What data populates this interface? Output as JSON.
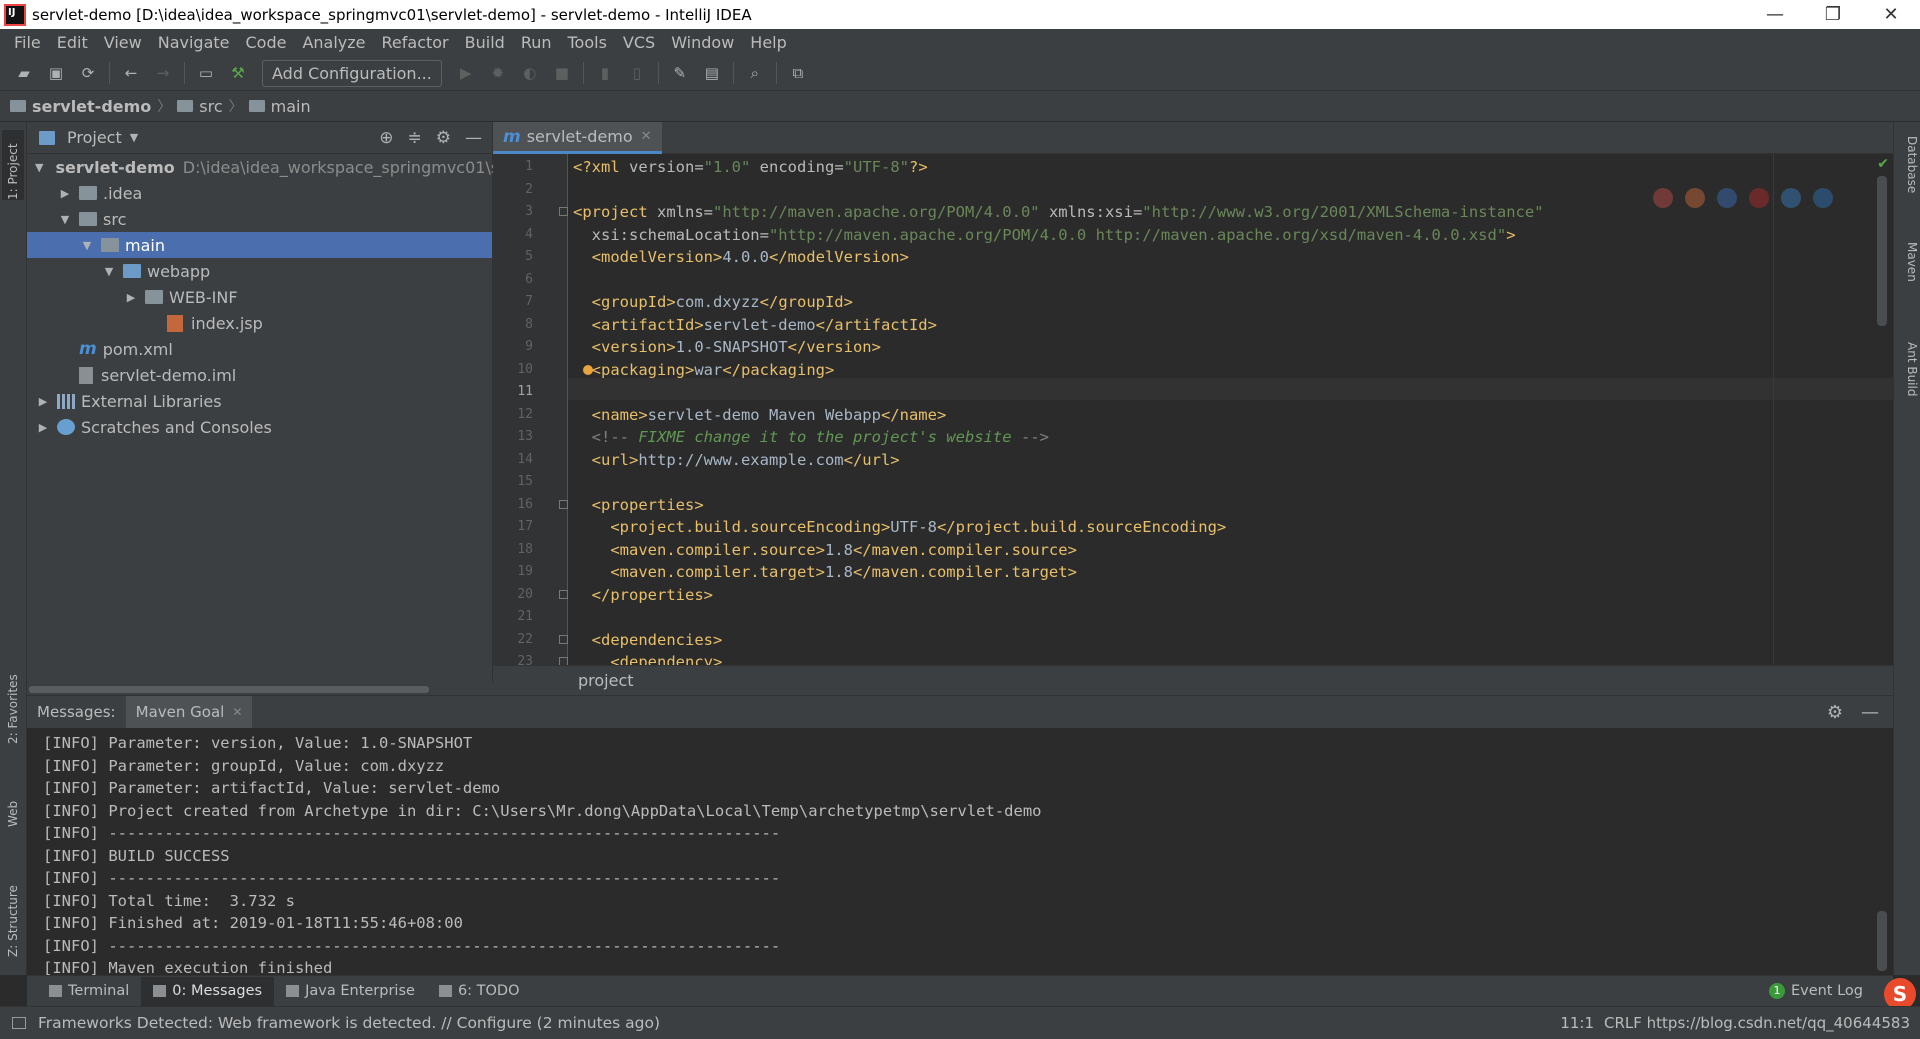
{
  "window": {
    "title": "servlet-demo [D:\\idea\\idea_workspace_springmvc01\\servlet-demo] - servlet-demo - IntelliJ IDEA",
    "controls": [
      "—",
      "❐",
      "✕"
    ]
  },
  "menu": [
    "File",
    "Edit",
    "View",
    "Navigate",
    "Code",
    "Analyze",
    "Refactor",
    "Build",
    "Run",
    "Tools",
    "VCS",
    "Window",
    "Help"
  ],
  "toolbar": {
    "add_configuration": "Add Configuration..."
  },
  "navbar": {
    "crumbs": [
      "servlet-demo",
      "src",
      "main"
    ]
  },
  "left_stripe": {
    "project": "1: Project",
    "favorites": "2: Favorites",
    "web": "Web",
    "structure": "Z: Structure"
  },
  "right_stripe": {
    "database": "Database",
    "maven": "Maven",
    "ant": "Ant Build"
  },
  "project_panel": {
    "title": "Project",
    "tree": [
      {
        "label": "servlet-demo",
        "hint": "D:\\idea\\idea_workspace_springmvc01\\serv",
        "depth": 0,
        "arrow": "▼",
        "icon": "folder",
        "bold": true
      },
      {
        "label": ".idea",
        "depth": 1,
        "arrow": "▶",
        "icon": "folder"
      },
      {
        "label": "src",
        "depth": 1,
        "arrow": "▼",
        "icon": "folder"
      },
      {
        "label": "main",
        "depth": 2,
        "arrow": "▼",
        "icon": "folder",
        "selected": true
      },
      {
        "label": "webapp",
        "depth": 3,
        "arrow": "▼",
        "icon": "web-folder"
      },
      {
        "label": "WEB-INF",
        "depth": 4,
        "arrow": "▶",
        "icon": "folder"
      },
      {
        "label": "index.jsp",
        "depth": 5,
        "arrow": "",
        "icon": "jsp"
      },
      {
        "label": "pom.xml",
        "depth": 1,
        "arrow": "",
        "icon": "maven"
      },
      {
        "label": "servlet-demo.iml",
        "depth": 1,
        "arrow": "",
        "icon": "file"
      },
      {
        "label": "External Libraries",
        "depth": 0,
        "arrow": "▶",
        "icon": "library"
      },
      {
        "label": "Scratches and Consoles",
        "depth": 0,
        "arrow": "▶",
        "icon": "scratch"
      }
    ]
  },
  "editor": {
    "tab_label": "servlet-demo",
    "current_line": 11,
    "breadcrumb": "project",
    "lines": [
      {
        "n": 1,
        "parts": [
          [
            "t",
            "<?xml "
          ],
          [
            "a",
            "version="
          ],
          [
            "v",
            "\"1.0\""
          ],
          [
            "a",
            " encoding="
          ],
          [
            "v",
            "\"UTF-8\""
          ],
          [
            "t",
            "?>"
          ]
        ]
      },
      {
        "n": 2,
        "parts": []
      },
      {
        "n": 3,
        "parts": [
          [
            "t",
            "<project "
          ],
          [
            "a",
            "xmlns="
          ],
          [
            "v",
            "\"http://maven.apache.org/POM/4.0.0\""
          ],
          [
            "a",
            " xmlns:xsi="
          ],
          [
            "v",
            "\"http://www.w3.org/2001/XMLSchema-instance\""
          ]
        ]
      },
      {
        "n": 4,
        "parts": [
          [
            "a",
            "  xsi:schemaLocation="
          ],
          [
            "v",
            "\"http://maven.apache.org/POM/4.0.0 http://maven.apache.org/xsd/maven-4.0.0.xsd\""
          ],
          [
            "t",
            ">"
          ]
        ]
      },
      {
        "n": 5,
        "parts": [
          [
            "t",
            "  <modelVersion>"
          ],
          [
            "tx",
            "4.0.0"
          ],
          [
            "t",
            "</modelVersion>"
          ]
        ]
      },
      {
        "n": 6,
        "parts": []
      },
      {
        "n": 7,
        "parts": [
          [
            "t",
            "  <groupId>"
          ],
          [
            "tx",
            "com.dxyzz"
          ],
          [
            "t",
            "</groupId>"
          ]
        ]
      },
      {
        "n": 8,
        "parts": [
          [
            "t",
            "  <artifactId>"
          ],
          [
            "tx",
            "servlet-demo"
          ],
          [
            "t",
            "</artifactId>"
          ]
        ]
      },
      {
        "n": 9,
        "parts": [
          [
            "t",
            "  <version>"
          ],
          [
            "tx",
            "1.0-SNAPSHOT"
          ],
          [
            "t",
            "</version>"
          ]
        ]
      },
      {
        "n": 10,
        "parts": [
          [
            "t",
            "  <packaging>"
          ],
          [
            "tx",
            "war"
          ],
          [
            "t",
            "</packaging>"
          ]
        ],
        "bulb": true
      },
      {
        "n": 11,
        "parts": []
      },
      {
        "n": 12,
        "parts": [
          [
            "t",
            "  <name>"
          ],
          [
            "tx",
            "servlet-demo Maven Webapp"
          ],
          [
            "t",
            "</name>"
          ]
        ]
      },
      {
        "n": 13,
        "parts": [
          [
            "cmd",
            "  <!-- "
          ],
          [
            "cm",
            "FIXME change it to the project's website"
          ],
          [
            "cmd",
            " -->"
          ]
        ]
      },
      {
        "n": 14,
        "parts": [
          [
            "t",
            "  <url>"
          ],
          [
            "tx",
            "http://www.example.com"
          ],
          [
            "t",
            "</url>"
          ]
        ]
      },
      {
        "n": 15,
        "parts": []
      },
      {
        "n": 16,
        "parts": [
          [
            "t",
            "  <properties>"
          ]
        ]
      },
      {
        "n": 17,
        "parts": [
          [
            "t",
            "    <project.build.sourceEncoding>"
          ],
          [
            "tx",
            "UTF-8"
          ],
          [
            "t",
            "</project.build.sourceEncoding>"
          ]
        ]
      },
      {
        "n": 18,
        "parts": [
          [
            "t",
            "    <maven.compiler.source>"
          ],
          [
            "tx",
            "1.8"
          ],
          [
            "t",
            "</maven.compiler.source>"
          ]
        ]
      },
      {
        "n": 19,
        "parts": [
          [
            "t",
            "    <maven.compiler.target>"
          ],
          [
            "tx",
            "1.8"
          ],
          [
            "t",
            "</maven.compiler.target>"
          ]
        ]
      },
      {
        "n": 20,
        "parts": [
          [
            "t",
            "  </properties>"
          ]
        ]
      },
      {
        "n": 21,
        "parts": []
      },
      {
        "n": 22,
        "parts": [
          [
            "t",
            "  <dependencies>"
          ]
        ]
      },
      {
        "n": 23,
        "parts": [
          [
            "t",
            "    <dependency>"
          ]
        ]
      }
    ],
    "fold_lines": [
      3,
      16,
      20,
      22,
      23
    ]
  },
  "messages": {
    "label": "Messages:",
    "tab": "Maven Goal",
    "lines": [
      "[INFO] Parameter: version, Value: 1.0-SNAPSHOT",
      "[INFO] Parameter: groupId, Value: com.dxyzz",
      "[INFO] Parameter: artifactId, Value: servlet-demo",
      "[INFO] Project created from Archetype in dir: C:\\Users\\Mr.dong\\AppData\\Local\\Temp\\archetypetmp\\servlet-demo",
      "[INFO] ------------------------------------------------------------------------",
      "[INFO] BUILD SUCCESS",
      "[INFO] ------------------------------------------------------------------------",
      "[INFO] Total time:  3.732 s",
      "[INFO] Finished at: 2019-01-18T11:55:46+08:00",
      "[INFO] ------------------------------------------------------------------------",
      "[INFO] Maven execution finished"
    ]
  },
  "bottom_tabs": {
    "terminal": "Terminal",
    "messages": "0: Messages",
    "java_enterprise": "Java Enterprise",
    "todo": "6: TODO",
    "event_log": "Event Log",
    "event_badge": "1"
  },
  "status": {
    "text": "Frameworks Detected: Web framework is detected. // Configure (2 minutes ago)",
    "position": "11:1",
    "right_text": "CRLF  https://blog.csdn.net/qq_40644583"
  },
  "colors": {
    "selection": "#4b6eaf",
    "tag": "#e8bf6a",
    "string": "#6a8759",
    "comment": "#629755"
  }
}
